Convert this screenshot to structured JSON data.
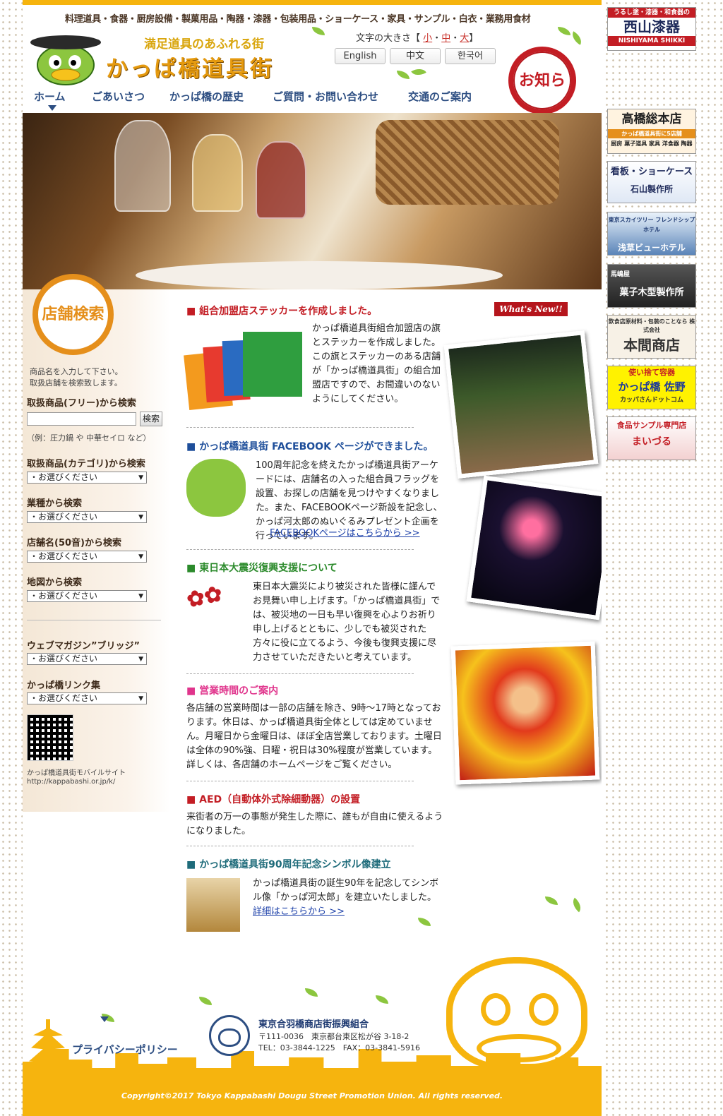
{
  "header": {
    "categories": "料理道具・食器・厨房設備・製菓用品・陶器・漆器・包装用品・ショーケース・家具・サンプル・白衣・業務用食材",
    "tagline": "満足道具のあふれる街",
    "title": "かっぱ橋道具街",
    "font_size_label": "文字の大きさ【",
    "font_size_close": "】",
    "font_small": "小",
    "font_medium": "中",
    "font_large": "大",
    "lang_en": "English",
    "lang_zh": "中文",
    "lang_ko": "한국어",
    "notice_badge": "お知らせ"
  },
  "nav": [
    "ホーム",
    "ごあいさつ",
    "かっぱ橋の歴史",
    "ご質問・お問い合わせ",
    "交通のご案内"
  ],
  "sidebar": {
    "title": "店舗検索",
    "intro1": "商品名を入力して下さい。",
    "intro2": "取扱店舗を検索致します。",
    "free_label": "取扱商品(フリー)から検索",
    "search_btn": "検索",
    "example": "（例：圧力鍋 や 中華セイロ など）",
    "category_label": "取扱商品(カテゴリ)から検索",
    "industry_label": "業種から検索",
    "kana_label": "店舗名(50音)から検索",
    "map_label": "地図から検索",
    "magazine_label": "ウェブマガジン”ブリッジ”",
    "links_label": "かっぱ橋リンク集",
    "select_default": "・お選びください",
    "mobile_label": "かっぱ橋道具街モバイルサイト",
    "mobile_url": "http://kappabashi.or.jp/k/"
  },
  "whats_new": "What's New!!",
  "news": [
    {
      "title": "組合加盟店ステッカーを作成しました。",
      "color": "#c31d24",
      "body": "かっぱ橋道具街組合加盟店の旗とステッカーを作成しました。この旗とステッカーのある店舗が「かっぱ橋道具街」の組合加盟店ですので、お間違いのないようにしてください。"
    },
    {
      "title": "かっぱ橋道具街 FACEBOOK ページができました。",
      "color": "#1e4e9a",
      "body": "100周年記念を終えたかっぱ橋道具街アーケードには、店舗名の入った組合員フラッグを設置、お探しの店舗を見つけやすくなりました。また、FACEBOOKページ新設を記念し、かっぱ河太郎のぬいぐるみプレゼント企画を行っています。",
      "link": "FACEBOOKページはこちらから >>"
    },
    {
      "title": "東日本大震災復興支援について",
      "color": "#2b8a2b",
      "body": "東日本大震災により被災された皆様に謹んでお見舞い申し上げます。「かっぱ橋道具街」では、被災地の一日も早い復興を心よりお祈り申し上げるとともに、少しでも被災された方々に役に立てるよう、今後も復興支援に尽力させていただきたいと考えています。"
    },
    {
      "title": "営業時間のご案内",
      "color": "#e0348c",
      "body": "各店舗の営業時間は一部の店舗を除き、9時～17時となっております。休日は、かっぱ橋道具街全体としては定めていません。月曜日から金曜日は、ほぼ全店営業しております。土曜日は全体の90%強、日曜・祝日は30%程度が営業しています。詳しくは、各店舗のホームページをご覧ください。"
    },
    {
      "title": "AED（自動体外式除細動器）の設置",
      "color": "#c31d24",
      "body": "来街者の万一の事態が発生した際に、誰もが自由に使えるようになりました。"
    },
    {
      "title": "かっぱ橋道具街90周年記念シンボル像建立",
      "color": "#1e6b7a",
      "body": "かっぱ橋道具街の誕生90年を記念してシンボル像「かっぱ河太郎」を建立いたしました。",
      "link": "詳細はこちらから >>"
    }
  ],
  "footer": {
    "privacy": "プライバシーポリシー",
    "org": "東京合羽橋商店街振興組合",
    "postal": "〒111-0036　東京都台東区松が谷 3-18-2",
    "phone": "TEL：03-3844-1225　FAX：03-3841-5916",
    "copyright": "Copyright©2017 Tokyo Kappabashi Dougu Street Promotion Union. All rights reserved."
  },
  "ads": [
    {
      "small": "うるし塗・漆器・和食器の",
      "main": "西山漆器",
      "sub": "NISHIYAMA SHIKKI"
    },
    {
      "main": "高橋総本店",
      "sub": "かっぱ橋道具街に5店舗",
      "sub2": "厨房 菓子道具 家具 洋食器 陶器"
    },
    {
      "main": "看板・ショーケース",
      "sub": "石山製作所"
    },
    {
      "small": "東京スカイツリー フレンドシップホテル",
      "main": "浅草ビューホテル"
    },
    {
      "small": "馬嶋屋",
      "main": "菓子木型製作所"
    },
    {
      "small": "飲食店原材料・包装のことなら 株式会社",
      "main": "本間商店"
    },
    {
      "small": "使い捨て容器",
      "main": "かっぱ橋 佐野",
      "sub": "カッパさんドットコム"
    },
    {
      "main": "食品サンプル専門店",
      "sub": "まいづる"
    }
  ],
  "colors": {
    "accent": "#f6b40e",
    "nav": "#2d4e82",
    "red": "#c31d24"
  }
}
